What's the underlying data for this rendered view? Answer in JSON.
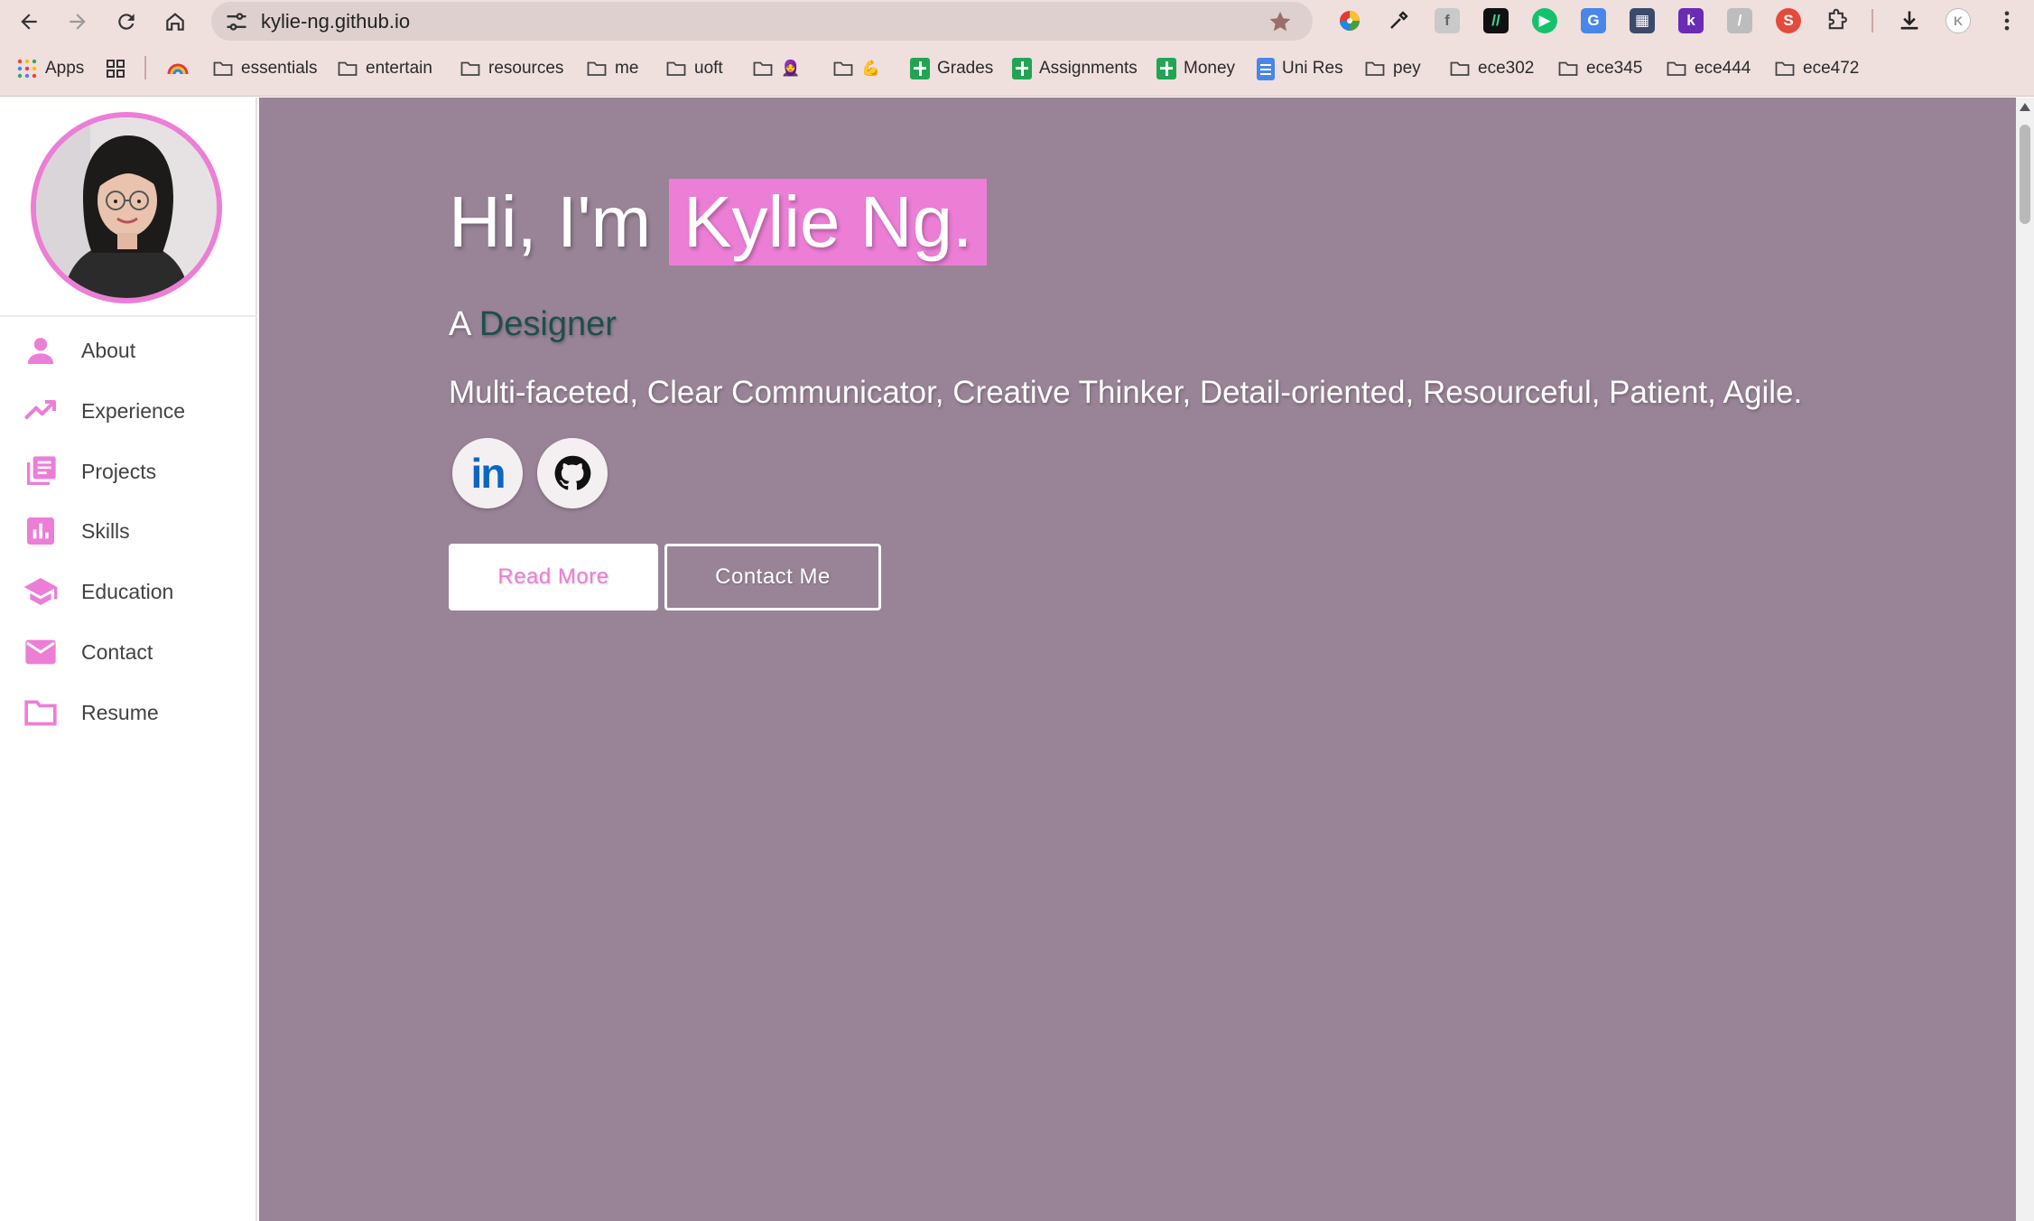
{
  "browser": {
    "url": "kylie-ng.github.io",
    "nav": {
      "back": "back-icon",
      "forward": "forward-icon",
      "reload": "reload-icon",
      "home": "home-icon"
    },
    "bookmarks": [
      {
        "label": "Apps",
        "icon": "apps-grid-icon"
      },
      {
        "label": "",
        "icon": "tab-groups-icon"
      },
      {
        "label": "",
        "icon": "rainbow-icon"
      },
      {
        "label": "essentials",
        "icon": "folder-icon"
      },
      {
        "label": "entertain",
        "icon": "folder-icon"
      },
      {
        "label": "resources",
        "icon": "folder-icon"
      },
      {
        "label": "me",
        "icon": "folder-icon"
      },
      {
        "label": "uoft",
        "icon": "folder-icon"
      },
      {
        "label": "🧕",
        "icon": "folder-icon"
      },
      {
        "label": "💪",
        "icon": "folder-icon"
      },
      {
        "label": "Grades",
        "icon": "sheets-icon"
      },
      {
        "label": "Assignments",
        "icon": "sheets-icon"
      },
      {
        "label": "Money",
        "icon": "sheets-icon"
      },
      {
        "label": "Uni Res",
        "icon": "docs-icon"
      },
      {
        "label": "pey",
        "icon": "folder-icon"
      },
      {
        "label": "ece302",
        "icon": "folder-icon"
      },
      {
        "label": "ece345",
        "icon": "folder-icon"
      },
      {
        "label": "ece444",
        "icon": "folder-icon"
      },
      {
        "label": "ece472",
        "icon": "folder-icon"
      }
    ],
    "profile_initial": "K"
  },
  "sidebar": {
    "items": [
      {
        "label": "About",
        "icon": "person-icon"
      },
      {
        "label": "Experience",
        "icon": "trending-up-icon"
      },
      {
        "label": "Projects",
        "icon": "library-books-icon"
      },
      {
        "label": "Skills",
        "icon": "bar-chart-icon"
      },
      {
        "label": "Education",
        "icon": "graduation-cap-icon"
      },
      {
        "label": "Contact",
        "icon": "mail-icon"
      },
      {
        "label": "Resume",
        "icon": "folder-icon"
      }
    ]
  },
  "hero": {
    "greeting": "Hi, I'm",
    "name": "Kylie Ng.",
    "article": "A",
    "role": "Designer",
    "traits": "Multi-faceted, Clear Communicator, Creative Thinker, Detail-oriented, Resourceful, Patient, Agile.",
    "social": {
      "linkedin_text": "in"
    },
    "read_more_label": "Read More",
    "contact_label": "Contact Me"
  },
  "colors": {
    "accent": "#ec7ed6",
    "main_bg": "#988496",
    "chrome_bg": "#efdfdd",
    "role_text": "#1f4e4e"
  }
}
